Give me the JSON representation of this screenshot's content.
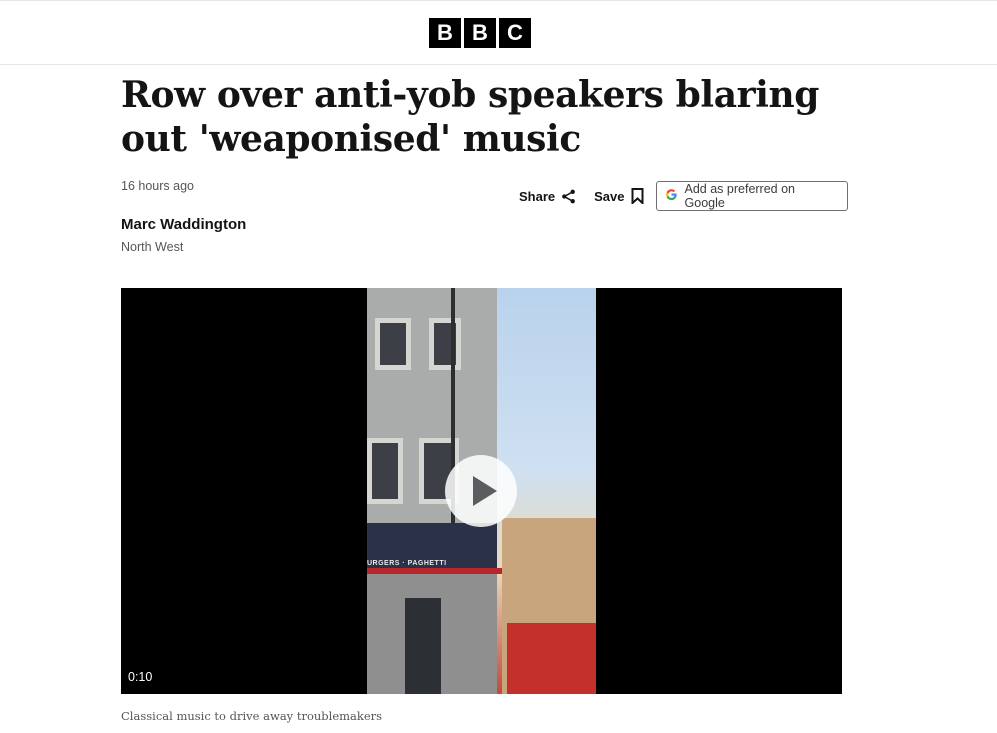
{
  "header": {
    "logo_letters": [
      "B",
      "B",
      "C"
    ]
  },
  "article": {
    "headline": "Row over anti-yob speakers blaring out 'weaponised' music",
    "timestamp": "16 hours ago",
    "author": "Marc Waddington",
    "location": "North West"
  },
  "actions": {
    "share_label": "Share",
    "save_label": "Save",
    "google_label": "Add as preferred on Google",
    "share_icon": "share-icon",
    "save_icon": "bookmark-icon",
    "google_icon": "google-g-icon"
  },
  "video": {
    "duration": "0:10",
    "shop_sign": "URGERS · PAGHETTI",
    "caption": "Classical music to drive away troublemakers"
  }
}
